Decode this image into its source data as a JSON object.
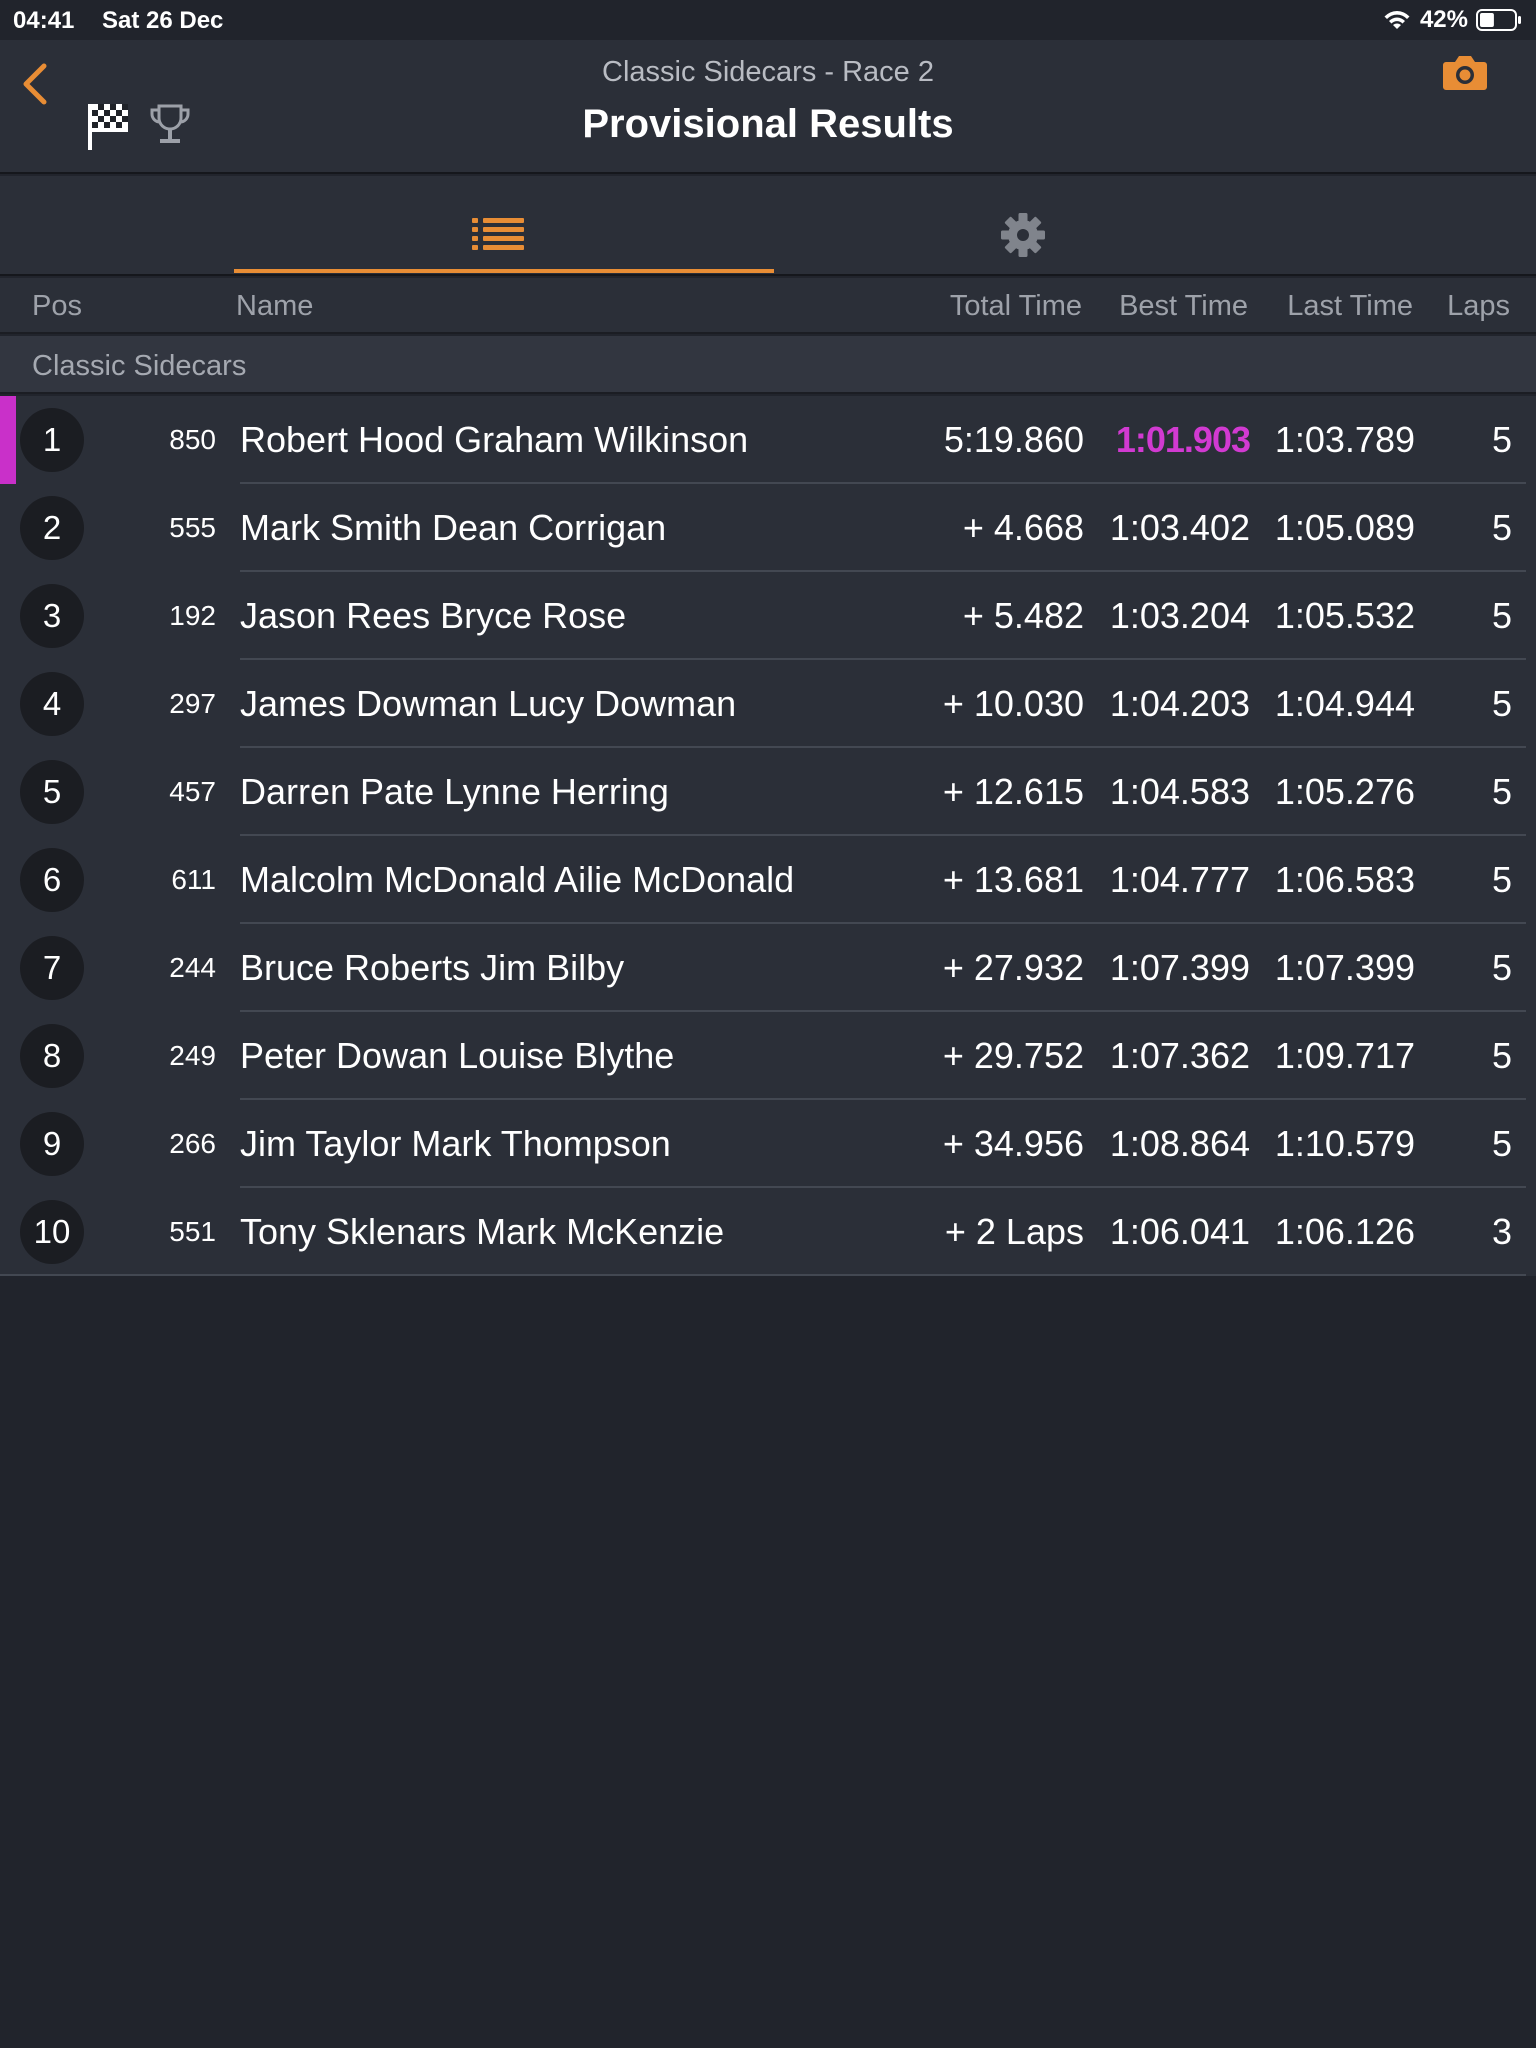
{
  "status_bar": {
    "time": "04:41",
    "date": "Sat 26 Dec",
    "battery": "42%",
    "battery_level": 0.42
  },
  "header": {
    "subtitle": "Classic Sidecars - Race 2",
    "title": "Provisional Results"
  },
  "icons": {
    "back": "chevron-left-icon",
    "flag": "checkered-flag-icon",
    "trophy": "trophy-icon",
    "camera": "camera-icon",
    "list": "list-icon",
    "settings": "gear-icon"
  },
  "colors": {
    "accent": "#e88d35",
    "fastest": "#d13ad1",
    "background": "#21242c",
    "row": "#2b2f38"
  },
  "columns": {
    "pos": "Pos",
    "name": "Name",
    "total": "Total Time",
    "best": "Best Time",
    "last": "Last Time",
    "laps": "Laps"
  },
  "class_name": "Classic Sidecars",
  "results": [
    {
      "pos": "1",
      "num": "850",
      "name": "Robert Hood Graham Wilkinson",
      "total": "5:19.860",
      "best": "1:01.903",
      "last": "1:03.789",
      "laps": "5"
    },
    {
      "pos": "2",
      "num": "555",
      "name": "Mark Smith Dean Corrigan",
      "total": "+ 4.668",
      "best": "1:03.402",
      "last": "1:05.089",
      "laps": "5"
    },
    {
      "pos": "3",
      "num": "192",
      "name": "Jason Rees Bryce Rose",
      "total": "+ 5.482",
      "best": "1:03.204",
      "last": "1:05.532",
      "laps": "5"
    },
    {
      "pos": "4",
      "num": "297",
      "name": "James Dowman Lucy Dowman",
      "total": "+ 10.030",
      "best": "1:04.203",
      "last": "1:04.944",
      "laps": "5"
    },
    {
      "pos": "5",
      "num": "457",
      "name": "Darren Pate Lynne Herring",
      "total": "+ 12.615",
      "best": "1:04.583",
      "last": "1:05.276",
      "laps": "5"
    },
    {
      "pos": "6",
      "num": "611",
      "name": "Malcolm McDonald Ailie McDonald",
      "total": "+ 13.681",
      "best": "1:04.777",
      "last": "1:06.583",
      "laps": "5"
    },
    {
      "pos": "7",
      "num": "244",
      "name": "Bruce Roberts Jim Bilby",
      "total": "+ 27.932",
      "best": "1:07.399",
      "last": "1:07.399",
      "laps": "5"
    },
    {
      "pos": "8",
      "num": "249",
      "name": "Peter Dowan Louise Blythe",
      "total": "+ 29.752",
      "best": "1:07.362",
      "last": "1:09.717",
      "laps": "5"
    },
    {
      "pos": "9",
      "num": "266",
      "name": "Jim Taylor Mark Thompson",
      "total": "+ 34.956",
      "best": "1:08.864",
      "last": "1:10.579",
      "laps": "5"
    },
    {
      "pos": "10",
      "num": "551",
      "name": "Tony Sklenars Mark McKenzie",
      "total": "+ 2 Laps",
      "best": "1:06.041",
      "last": "1:06.126",
      "laps": "3"
    }
  ]
}
